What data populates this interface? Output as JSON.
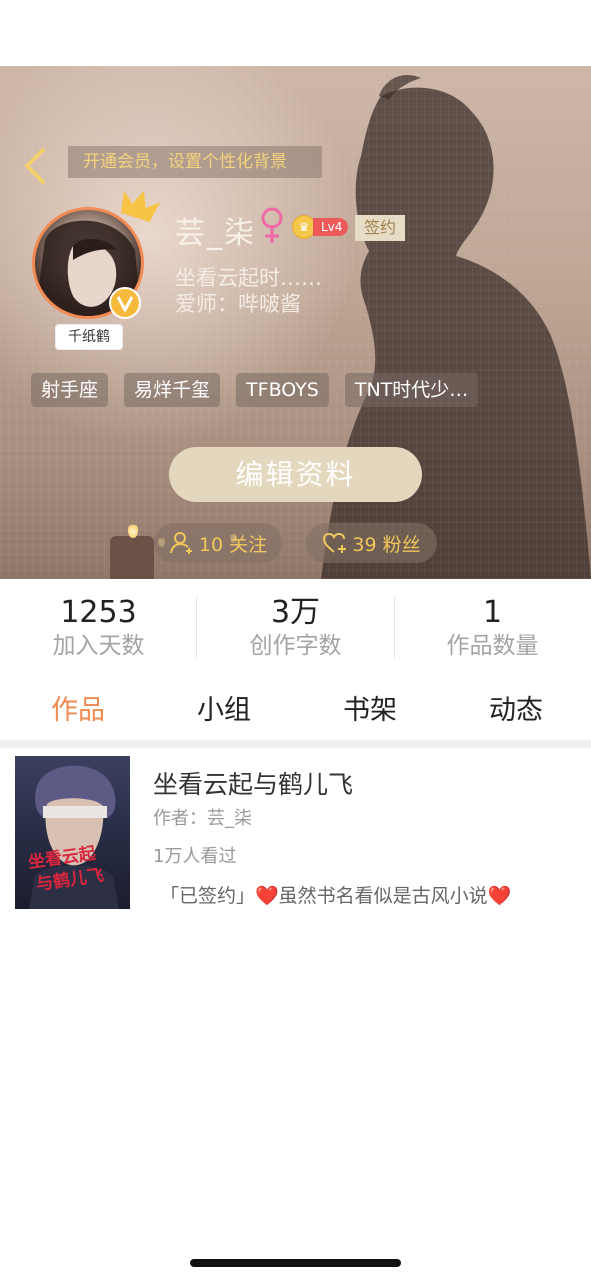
{
  "header": {
    "vip_banner": "开通会员，设置个性化背景",
    "username": "芸_柒",
    "level": "Lv4",
    "signed_badge": "签约",
    "bio_line1": "坐看云起时……",
    "bio_line2": "爱师：哔啵酱",
    "avatar_tag": "千纸鹤",
    "tags": [
      "射手座",
      "易烊千玺",
      "TFBOYS",
      "TNT时代少…"
    ],
    "edit_button": "编辑资料",
    "follow_label": "10 关注",
    "fans_label": "39 粉丝"
  },
  "stats": [
    {
      "value": "1253",
      "label": "加入天数"
    },
    {
      "value": "3万",
      "label": "创作字数"
    },
    {
      "value": "1",
      "label": "作品数量"
    }
  ],
  "tabs": [
    {
      "label": "作品",
      "active": true
    },
    {
      "label": "小组",
      "active": false
    },
    {
      "label": "书架",
      "active": false
    },
    {
      "label": "动态",
      "active": false
    }
  ],
  "book": {
    "title": "坐看云起与鹤儿飞",
    "author": "作者：芸_柒",
    "reads": "1万人看过",
    "description": "「已签约」❤️虽然书名看似是古风小说❤️",
    "cover_text": "坐看云起与鹤儿飞"
  },
  "colors": {
    "accent": "#f08a4f",
    "gold_text": "#f1c75b",
    "edit_button_bg": "#e3d8bd"
  },
  "icons": {
    "back": "chevron-left-icon",
    "female": "female-symbol-icon",
    "follow": "person-plus-icon",
    "fans": "heart-plus-icon",
    "crown": "crown-icon",
    "verified": "v-badge-icon"
  }
}
